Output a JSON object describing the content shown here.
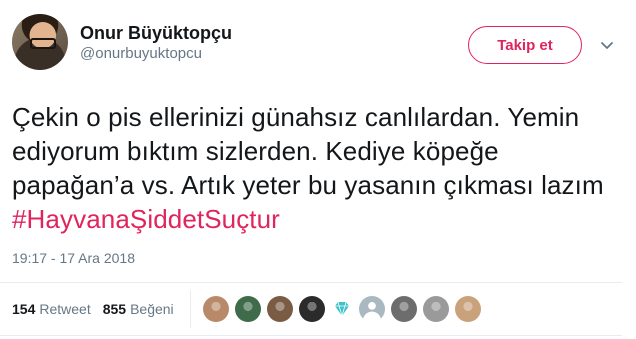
{
  "user": {
    "display_name": "Onur Büyüktopçu",
    "handle": "@onurbuyuktopcu"
  },
  "follow_label": "Takip et",
  "tweet": {
    "text_before": "Çekin o pis ellerinizi günahsız canlılardan. Yemin ediyorum bıktım sizlerden. Kediye köpeğe papağan’a vs.  Artık yeter bu yasanın çıkması lazım ",
    "hashtag": "#HayvanaŞiddetSuçtur",
    "timestamp": "19:17 - 17 Ara 2018"
  },
  "stats": {
    "retweet_count": "154",
    "retweet_label": "Retweet",
    "like_count": "855",
    "like_label": "Beğeni"
  },
  "likers": [
    {
      "icon": "avatar",
      "color": "#b88a6a"
    },
    {
      "icon": "avatar",
      "color": "#3f6b4a"
    },
    {
      "icon": "avatar",
      "color": "#7a5c44"
    },
    {
      "icon": "avatar",
      "color": "#2b2b2b"
    },
    {
      "icon": "diamond-icon",
      "color": "#3fc1c9"
    },
    {
      "icon": "default-avatar-icon",
      "color": "#aab8c2"
    },
    {
      "icon": "avatar",
      "color": "#6d6d6d"
    },
    {
      "icon": "avatar",
      "color": "#9a9a9a"
    },
    {
      "icon": "avatar",
      "color": "#c9a27c"
    }
  ],
  "colors": {
    "accent": "#e0245e",
    "secondary_text": "#657786",
    "primary_text": "#14171a"
  }
}
